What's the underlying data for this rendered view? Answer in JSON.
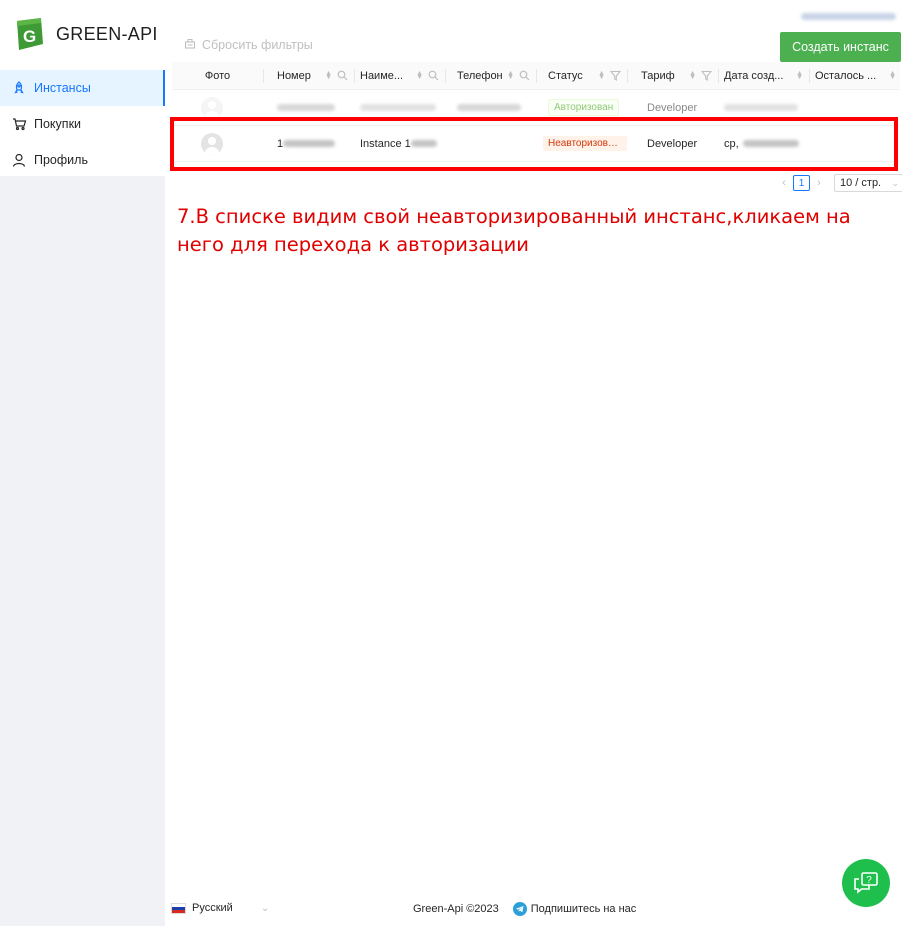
{
  "app": {
    "name": "GREEN-API"
  },
  "colors": {
    "brand_green": "#4caf50",
    "accent_blue": "#1677ff",
    "annotation_red": "#e00000",
    "chat_button": "#1fbf4d"
  },
  "sidebar": {
    "items": [
      {
        "label": "Инстансы",
        "icon": "rocket-icon",
        "active": true
      },
      {
        "label": "Покупки",
        "icon": "cart-icon",
        "active": false
      },
      {
        "label": "Профиль",
        "icon": "user-icon",
        "active": false
      }
    ]
  },
  "toolbar": {
    "reset_filters": "Сбросить фильтры",
    "create_instance": "Создать инстанс"
  },
  "table": {
    "columns": [
      "Фото",
      "Номер",
      "Наиме...",
      "Телефон",
      "Статус",
      "Тариф",
      "Дата созд...",
      "Осталось ..."
    ],
    "rows": [
      {
        "number": "",
        "name": "",
        "phone": "",
        "status": "Авторизован",
        "tariff": "Developer",
        "date": ""
      },
      {
        "number": "1",
        "name": "Instance 1",
        "phone": "",
        "status": "Неавторизованный",
        "tariff": "Developer",
        "date": "ср,"
      }
    ]
  },
  "pagination": {
    "current_page": "1",
    "page_size": "10 / стр."
  },
  "annotation": "7.В списке видим свой неавторизированный инстанс,кликаем на него для перехода к авторизации",
  "footer": {
    "language": "Русский",
    "copyright": "Green-Api ©2023",
    "subscribe": "Подпишитесь на нас"
  }
}
